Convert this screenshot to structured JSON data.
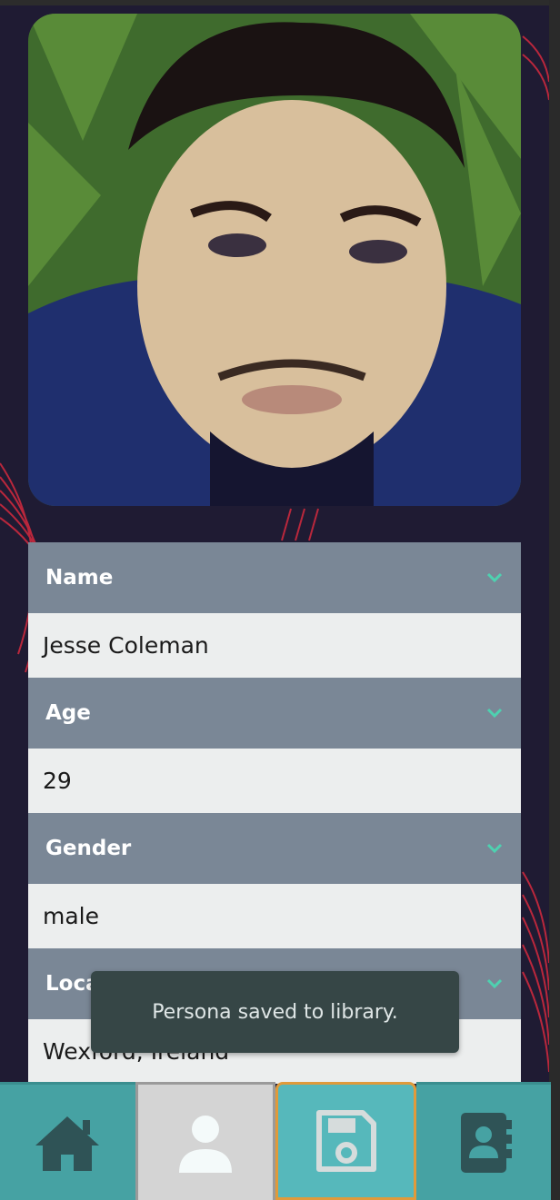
{
  "profile": {
    "photo_alt": "Profile photo",
    "fields": [
      {
        "label": "Name",
        "value": "Jesse Coleman"
      },
      {
        "label": "Age",
        "value": "29"
      },
      {
        "label": "Gender",
        "value": "male"
      },
      {
        "label": "Location",
        "value": "Wexford, Ireland"
      }
    ]
  },
  "toast": {
    "message": "Persona saved to library."
  },
  "nav": {
    "items": [
      {
        "icon": "home-icon"
      },
      {
        "icon": "user-icon"
      },
      {
        "icon": "save-icon"
      },
      {
        "icon": "contacts-book-icon"
      }
    ]
  },
  "colors": {
    "header": "#7a8796",
    "value_bg": "#eceeee",
    "chevron": "#4ed1b0",
    "nav": "#46a2a3",
    "toast": "#364646",
    "accent_save_border": "#e09a3a"
  }
}
